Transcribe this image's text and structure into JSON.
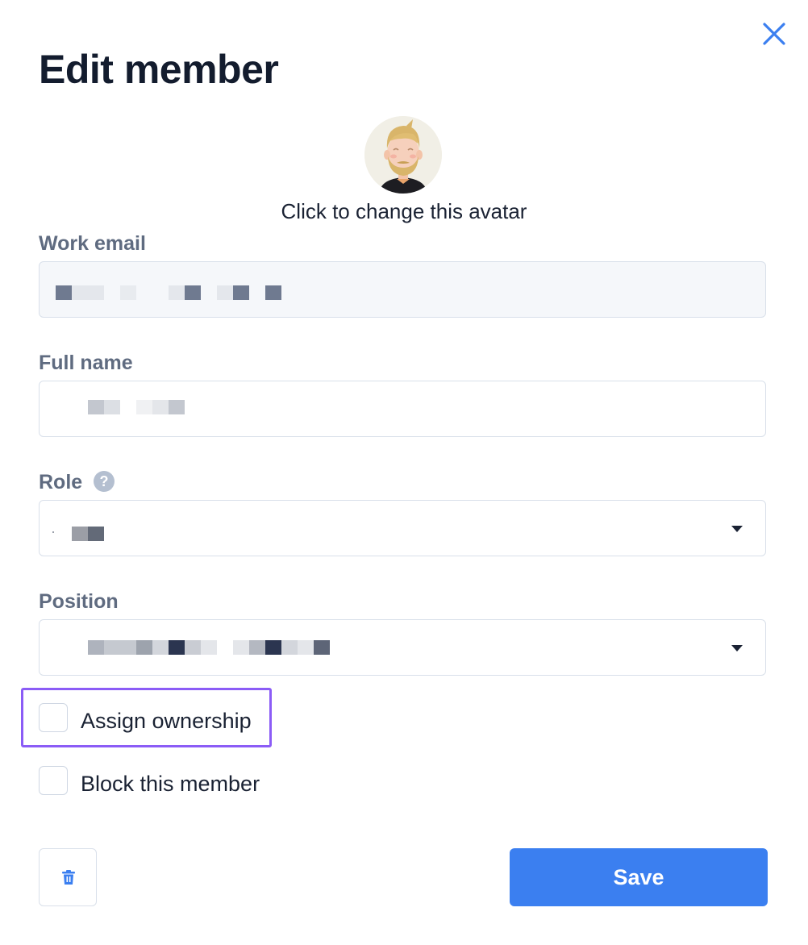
{
  "dialog": {
    "title": "Edit member",
    "close_icon": "close-icon"
  },
  "avatar": {
    "caption": "Click to change this avatar",
    "icon": "avatar-illustration"
  },
  "form": {
    "work_email": {
      "label": "Work email"
    },
    "full_name": {
      "label": "Full name"
    },
    "role": {
      "label": "Role",
      "help_icon": "question-circle-icon",
      "help_glyph": "?"
    },
    "position": {
      "label": "Position"
    }
  },
  "options": {
    "assign_ownership": {
      "label": "Assign ownership",
      "checked": false
    },
    "block_member": {
      "label": "Block this member",
      "checked": false
    }
  },
  "actions": {
    "delete_icon": "trash-icon",
    "save_label": "Save"
  },
  "colors": {
    "accent": "#3b7ff0",
    "highlight": "#8b5cf6",
    "label": "#5f6b80",
    "border": "#d9e0ea"
  }
}
